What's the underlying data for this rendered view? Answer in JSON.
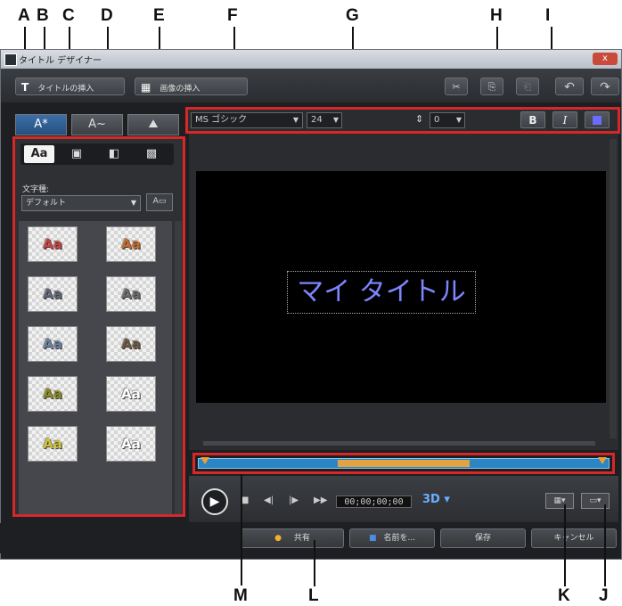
{
  "callouts": [
    "A",
    "B",
    "C",
    "D",
    "E",
    "F",
    "G",
    "H",
    "I",
    "J",
    "K",
    "L",
    "M"
  ],
  "window": {
    "title": "タイトル デザイナー",
    "close_label": "x"
  },
  "toolbar": {
    "insert_title": "タイトルの挿入",
    "insert_title_icon": "T",
    "insert_image": "画像の挿入",
    "insert_image_icon": "▦",
    "cut_icon": "✂",
    "copy_icon": "⎘",
    "paste_icon": "⎗",
    "undo_icon": "↶",
    "redo_icon": "↷"
  },
  "tabs": [
    "A*",
    "A~",
    "⛰"
  ],
  "left_panel": {
    "style_buttons": [
      "Aa",
      "▣",
      "◧",
      "▩"
    ],
    "font_type_label": "文字種:",
    "font_type_value": "デフォルト",
    "presets": [
      "Aa",
      "Aa",
      "Aa",
      "Aa",
      "Aa",
      "Aa",
      "Aa",
      "Aa",
      "Aa",
      "Aa"
    ],
    "preset_colors": [
      "#c94040",
      "#c66a2a",
      "#5f6478",
      "#6a6a6a",
      "#6a7fa0",
      "#6b5a40",
      "#8a8a20",
      "#ffffff",
      "#d1c23a",
      "#ffffff"
    ]
  },
  "font_bar": {
    "font_name": "MS ゴシック",
    "font_size": "24",
    "spacing_value": "0",
    "bold": "B",
    "italic": "I"
  },
  "preview": {
    "title_text": "マイ タイトル",
    "timecode": "00;00;00;00",
    "badge_3d": "3D"
  },
  "bottom": {
    "share": "共有",
    "save_as": "名前を...",
    "save": "保存",
    "cancel": "キャンセル"
  }
}
